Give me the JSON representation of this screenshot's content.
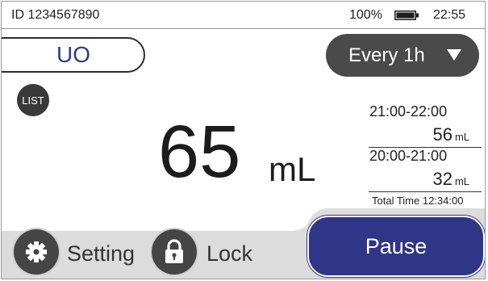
{
  "status_bar": {
    "device_id": "ID 1234567890",
    "battery_percent": "100%",
    "battery_icon": "battery-full-icon",
    "time": "22:55"
  },
  "measurement": {
    "label": "UO",
    "interval": "Every 1h",
    "list_label": "LIST",
    "current_value": "65",
    "current_unit": "mL"
  },
  "history": [
    {
      "period": "21:00-22:00",
      "value": "56",
      "unit": "mL"
    },
    {
      "period": "20:00-21:00",
      "value": "32",
      "unit": "mL"
    }
  ],
  "total_time": "Total Time 12:34:00",
  "bottom_bar": {
    "setting_label": "Setting",
    "setting_icon": "gear-icon",
    "lock_label": "Lock",
    "lock_icon": "padlock-icon",
    "pause_label": "Pause"
  },
  "colors": {
    "accent": "#2f3587",
    "uo_text": "#2b3a8f",
    "dark_button": "#454545",
    "bottom_bar_bg": "#dcdcdc"
  }
}
